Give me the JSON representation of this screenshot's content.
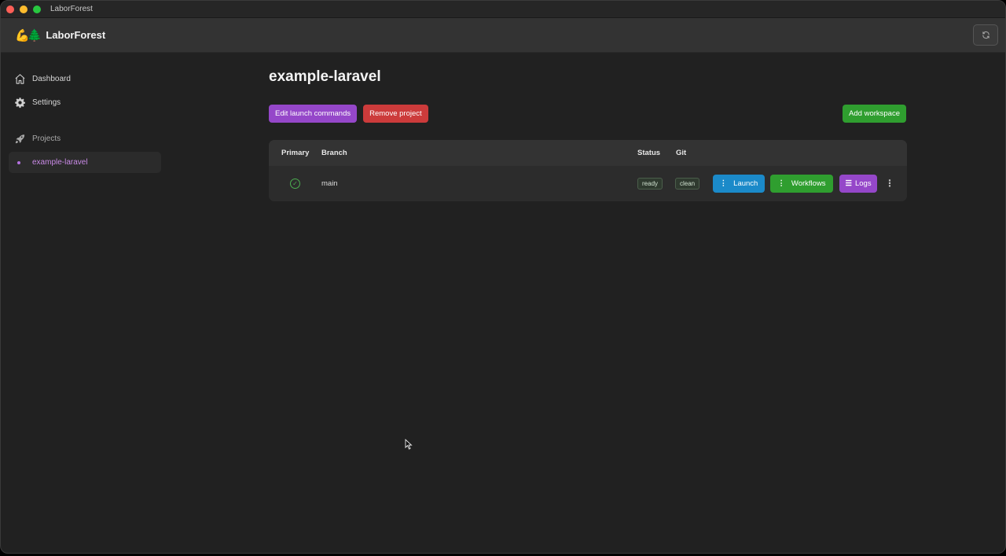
{
  "window": {
    "title": "LaborForest"
  },
  "header": {
    "brand": "LaborForest",
    "logo_glyphs": "💪🌲",
    "refresh_icon": "refresh-icon"
  },
  "sidebar": {
    "items": [
      {
        "label": "Dashboard",
        "icon": "home-icon"
      },
      {
        "label": "Settings",
        "icon": "gear-icon"
      }
    ],
    "section": {
      "label": "Projects",
      "icon": "rocket-icon"
    },
    "projects": [
      {
        "label": "example-laravel",
        "active": true
      }
    ]
  },
  "main": {
    "title": "example-laravel",
    "actions": {
      "edit": "Edit launch commands",
      "remove": "Remove project",
      "add": "Add workspace"
    },
    "table": {
      "columns": {
        "primary": "Primary",
        "branch": "Branch",
        "status": "Status",
        "git": "Git"
      },
      "rows": [
        {
          "primary": true,
          "branch": "main",
          "status": "ready",
          "git": "clean",
          "launch": "Launch",
          "workflows": "Workflows",
          "logs": "Logs"
        }
      ]
    }
  },
  "colors": {
    "accent_purple": "#9547c9",
    "danger_red": "#cc3b3b",
    "success_green": "#2f9e2f",
    "launch_blue": "#1b8ac9"
  }
}
